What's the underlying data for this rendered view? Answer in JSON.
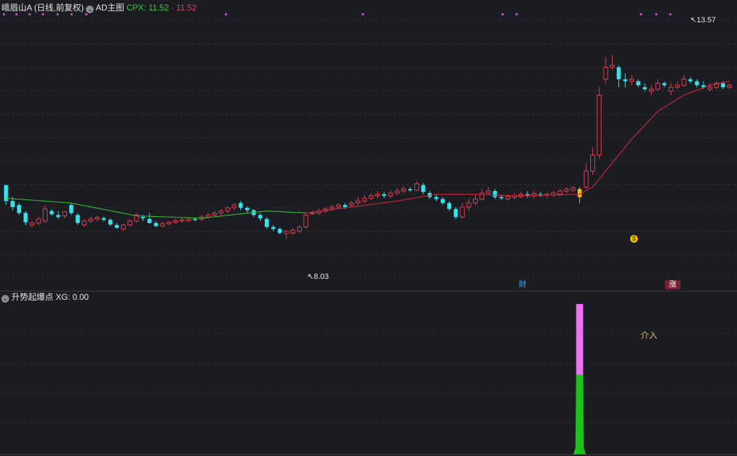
{
  "header": {
    "title": "峨眉山A",
    "period": "(日线,前复权)",
    "indicator_name": "AD主图",
    "cpx_label": "CPX:",
    "cpx_green": "11.52",
    "cpx_red": "11.52",
    "collapse_icon": "chevron-down-circle-icon"
  },
  "main_chart": {
    "high_label": "13.57",
    "low_label": "8.03",
    "event_badges": [
      "财",
      "涨"
    ],
    "marker_icon": "dollar-coin-icon"
  },
  "sub_panel": {
    "title": "升势起爆点",
    "xg_label": "XG:",
    "xg_value": "0.00",
    "annotation": "介入",
    "collapse_icon": "chevron-down-circle-icon"
  },
  "colors": {
    "background": "#1b1d22",
    "up": "#e0414f",
    "down": "#35e3ef",
    "ma_green": "#2fb72f",
    "ma_red": "#c8283a",
    "signal_yellow": "#f2c200",
    "signal_magenta": "#ee70ee",
    "signal_green": "#1dc01d",
    "grid": "#32353c"
  },
  "chart_data": {
    "type": "candlestick",
    "y_range": [
      7.6,
      14.2
    ],
    "price_extremes": {
      "high": 13.57,
      "low": 8.03
    },
    "candles": [
      [
        0,
        9.95,
        9.55,
        9.95,
        9.45
      ],
      [
        1,
        9.55,
        9.4,
        9.65,
        9.32
      ],
      [
        2,
        9.45,
        9.25,
        9.5,
        9.2
      ],
      [
        3,
        9.25,
        9.02,
        9.3,
        8.95
      ],
      [
        4,
        8.95,
        9.0,
        9.05,
        8.9
      ],
      [
        5,
        9.0,
        9.1,
        9.15,
        8.95
      ],
      [
        6,
        9.05,
        9.35,
        9.45,
        9.0
      ],
      [
        7,
        9.3,
        9.22,
        9.35,
        9.18
      ],
      [
        8,
        9.2,
        9.15,
        9.3,
        9.1
      ],
      [
        9,
        9.18,
        9.28,
        9.3,
        9.12
      ],
      [
        10,
        9.45,
        9.25,
        9.5,
        9.2
      ],
      [
        11,
        9.2,
        9.0,
        9.25,
        8.95
      ],
      [
        12,
        8.95,
        9.05,
        9.1,
        8.9
      ],
      [
        13,
        9.05,
        9.1,
        9.15,
        9.0
      ],
      [
        14,
        9.1,
        9.14,
        9.18,
        9.05
      ],
      [
        15,
        9.12,
        9.08,
        9.16,
        9.04
      ],
      [
        16,
        9.08,
        8.96,
        9.12,
        8.92
      ],
      [
        17,
        8.95,
        8.88,
        9.0,
        8.85
      ],
      [
        18,
        8.85,
        8.95,
        8.98,
        8.8
      ],
      [
        19,
        8.95,
        9.05,
        9.1,
        8.92
      ],
      [
        20,
        9.05,
        9.2,
        9.25,
        9.0
      ],
      [
        21,
        9.15,
        9.12,
        9.2,
        9.05
      ],
      [
        22,
        9.1,
        9.0,
        9.25,
        8.98
      ],
      [
        23,
        9.0,
        8.92,
        9.05,
        8.9
      ],
      [
        24,
        8.92,
        8.98,
        9.02,
        8.9
      ],
      [
        25,
        8.98,
        9.02,
        9.05,
        8.95
      ],
      [
        26,
        9.02,
        9.06,
        9.1,
        8.98
      ],
      [
        27,
        9.05,
        9.08,
        9.12,
        9.0
      ],
      [
        28,
        9.06,
        9.1,
        9.14,
        9.02
      ],
      [
        29,
        9.1,
        9.08,
        9.15,
        9.05
      ],
      [
        30,
        9.1,
        9.15,
        9.2,
        9.05
      ],
      [
        31,
        9.15,
        9.2,
        9.25,
        9.1
      ],
      [
        32,
        9.2,
        9.25,
        9.3,
        9.15
      ],
      [
        33,
        9.25,
        9.3,
        9.35,
        9.2
      ],
      [
        34,
        9.3,
        9.38,
        9.42,
        9.25
      ],
      [
        35,
        9.38,
        9.45,
        9.5,
        9.32
      ],
      [
        36,
        9.5,
        9.38,
        9.55,
        9.32
      ],
      [
        37,
        9.38,
        9.32,
        9.42,
        9.25
      ],
      [
        38,
        9.32,
        9.2,
        9.35,
        9.15
      ],
      [
        39,
        9.2,
        9.12,
        9.25,
        9.05
      ],
      [
        40,
        9.1,
        8.9,
        9.15,
        8.85
      ],
      [
        41,
        8.9,
        8.85,
        8.95,
        8.8
      ],
      [
        42,
        8.85,
        8.75,
        8.88,
        8.72
      ],
      [
        43,
        8.74,
        8.8,
        8.82,
        8.6
      ],
      [
        44,
        8.75,
        8.82,
        8.88,
        8.7
      ],
      [
        45,
        8.8,
        8.9,
        8.95,
        8.75
      ],
      [
        46,
        8.9,
        9.2,
        9.25,
        8.85
      ],
      [
        47,
        9.25,
        9.25,
        9.3,
        9.2
      ],
      [
        48,
        9.25,
        9.3,
        9.35,
        9.2
      ],
      [
        49,
        9.3,
        9.35,
        9.4,
        9.25
      ],
      [
        50,
        9.35,
        9.4,
        9.45,
        9.3
      ],
      [
        51,
        9.4,
        9.45,
        9.5,
        9.35
      ],
      [
        52,
        9.45,
        9.4,
        9.5,
        9.35
      ],
      [
        53,
        9.45,
        9.5,
        9.55,
        9.4
      ],
      [
        54,
        9.5,
        9.55,
        9.65,
        9.45
      ],
      [
        55,
        9.55,
        9.62,
        9.7,
        9.5
      ],
      [
        56,
        9.62,
        9.68,
        9.75,
        9.58
      ],
      [
        57,
        9.68,
        9.72,
        9.8,
        9.62
      ],
      [
        58,
        9.72,
        9.68,
        9.78,
        9.62
      ],
      [
        59,
        9.68,
        9.75,
        9.82,
        9.62
      ],
      [
        60,
        9.75,
        9.8,
        9.88,
        9.7
      ],
      [
        61,
        9.8,
        9.85,
        9.92,
        9.75
      ],
      [
        62,
        9.85,
        9.82,
        9.9,
        9.78
      ],
      [
        63,
        9.82,
        9.98,
        10.05,
        9.8
      ],
      [
        64,
        9.95,
        9.78,
        10.0,
        9.72
      ],
      [
        65,
        9.75,
        9.65,
        9.8,
        9.6
      ],
      [
        66,
        9.65,
        9.6,
        9.72,
        9.55
      ],
      [
        67,
        9.6,
        9.5,
        9.65,
        9.45
      ],
      [
        68,
        9.5,
        9.35,
        9.55,
        9.3
      ],
      [
        69,
        9.35,
        9.15,
        9.4,
        9.1
      ],
      [
        70,
        9.15,
        9.4,
        9.5,
        9.1
      ],
      [
        71,
        9.4,
        9.5,
        9.6,
        9.3
      ],
      [
        72,
        9.5,
        9.6,
        9.7,
        9.45
      ],
      [
        73,
        9.6,
        9.75,
        9.85,
        9.55
      ],
      [
        74,
        9.75,
        9.8,
        9.9,
        9.7
      ],
      [
        75,
        9.8,
        9.65,
        9.85,
        9.6
      ],
      [
        76,
        9.65,
        9.62,
        9.7,
        9.58
      ],
      [
        77,
        9.6,
        9.66,
        9.72,
        9.55
      ],
      [
        78,
        9.64,
        9.68,
        9.75,
        9.6
      ],
      [
        79,
        9.66,
        9.72,
        9.78,
        9.62
      ],
      [
        80,
        9.72,
        9.68,
        9.8,
        9.62
      ],
      [
        81,
        9.68,
        9.74,
        9.8,
        9.62
      ],
      [
        82,
        9.72,
        9.7,
        9.78,
        9.65
      ],
      [
        83,
        9.7,
        9.72,
        9.76,
        9.62
      ],
      [
        84,
        9.7,
        9.75,
        9.8,
        9.65
      ],
      [
        85,
        9.72,
        9.8,
        9.85,
        9.68
      ],
      [
        86,
        9.8,
        9.85,
        9.9,
        9.75
      ],
      [
        87,
        9.82,
        9.88,
        9.92,
        9.78
      ],
      [
        88,
        9.65,
        9.85,
        9.9,
        9.5
      ],
      [
        89,
        9.9,
        10.3,
        10.5,
        9.85
      ],
      [
        90,
        10.3,
        10.7,
        10.9,
        10.2
      ],
      [
        91,
        10.7,
        12.2,
        12.4,
        10.6
      ],
      [
        92,
        12.6,
        12.9,
        13.15,
        12.5
      ],
      [
        93,
        12.9,
        12.95,
        13.2,
        12.85
      ],
      [
        94,
        12.9,
        12.6,
        12.95,
        12.4
      ],
      [
        95,
        12.6,
        12.55,
        12.75,
        12.4
      ],
      [
        96,
        12.55,
        12.6,
        12.7,
        12.45
      ],
      [
        97,
        12.55,
        12.45,
        12.6,
        12.4
      ],
      [
        98,
        12.4,
        12.35,
        12.5,
        12.3
      ],
      [
        99,
        12.3,
        12.35,
        12.45,
        12.2
      ],
      [
        100,
        12.35,
        12.5,
        12.6,
        12.3
      ],
      [
        101,
        12.5,
        12.45,
        12.55,
        12.4
      ],
      [
        102,
        12.3,
        12.4,
        12.5,
        12.2
      ],
      [
        103,
        12.4,
        12.45,
        12.55,
        12.35
      ],
      [
        104,
        12.45,
        12.6,
        12.7,
        12.4
      ],
      [
        105,
        12.6,
        12.55,
        12.65,
        12.5
      ],
      [
        106,
        12.55,
        12.45,
        12.6,
        12.4
      ],
      [
        107,
        12.45,
        12.4,
        12.55,
        12.35
      ],
      [
        108,
        12.35,
        12.4,
        12.5,
        12.3
      ],
      [
        109,
        12.4,
        12.5,
        12.55,
        12.35
      ],
      [
        110,
        12.5,
        12.4,
        12.55,
        12.35
      ],
      [
        111,
        12.4,
        12.45,
        12.5,
        12.35
      ]
    ],
    "ma_points": [
      [
        0,
        9.62
      ],
      [
        10,
        9.5
      ],
      [
        20,
        9.18
      ],
      [
        30,
        9.12
      ],
      [
        40,
        9.3
      ],
      [
        46,
        9.25
      ],
      [
        52,
        9.38
      ],
      [
        60,
        9.55
      ],
      [
        66,
        9.72
      ],
      [
        72,
        9.72
      ],
      [
        78,
        9.68
      ],
      [
        84,
        9.7
      ],
      [
        88,
        9.72
      ],
      [
        90,
        9.9
      ],
      [
        93,
        10.5
      ],
      [
        96,
        11.1
      ],
      [
        100,
        11.8
      ],
      [
        104,
        12.2
      ],
      [
        108,
        12.45
      ],
      [
        111,
        12.55
      ]
    ],
    "signal": {
      "series": "XG",
      "total_segment_range": [
        0,
        1
      ],
      "green_fraction": 0.53
    }
  }
}
